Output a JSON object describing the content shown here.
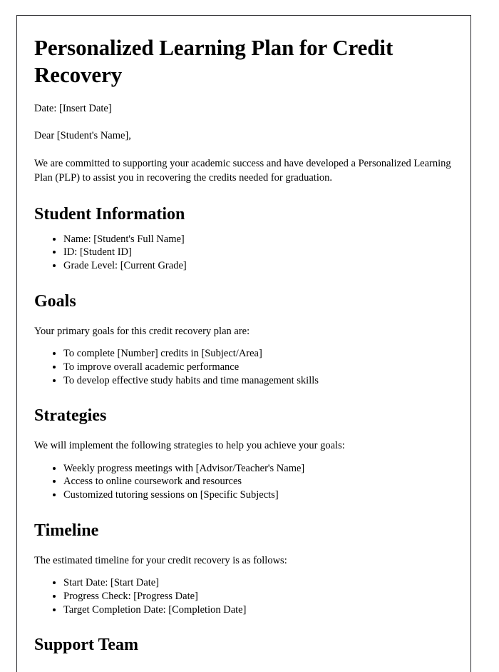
{
  "document": {
    "title": "Personalized Learning Plan for Credit Recovery",
    "date_line": "Date: [Insert Date]",
    "salutation": "Dear [Student's Name],",
    "intro_paragraph": "We are committed to supporting your academic success and have developed a Personalized Learning Plan (PLP) to assist you in recovering the credits needed for graduation.",
    "sections": {
      "student_information": {
        "heading": "Student Information",
        "items": [
          "Name: [Student's Full Name]",
          "ID: [Student ID]",
          "Grade Level: [Current Grade]"
        ]
      },
      "goals": {
        "heading": "Goals",
        "intro": "Your primary goals for this credit recovery plan are:",
        "items": [
          "To complete [Number] credits in [Subject/Area]",
          "To improve overall academic performance",
          "To develop effective study habits and time management skills"
        ]
      },
      "strategies": {
        "heading": "Strategies",
        "intro": "We will implement the following strategies to help you achieve your goals:",
        "items": [
          "Weekly progress meetings with [Advisor/Teacher's Name]",
          "Access to online coursework and resources",
          "Customized tutoring sessions on [Specific Subjects]"
        ]
      },
      "timeline": {
        "heading": "Timeline",
        "intro": "The estimated timeline for your credit recovery is as follows:",
        "items": [
          "Start Date: [Start Date]",
          "Progress Check: [Progress Date]",
          "Target Completion Date: [Completion Date]"
        ]
      },
      "support_team": {
        "heading": "Support Team"
      }
    }
  }
}
